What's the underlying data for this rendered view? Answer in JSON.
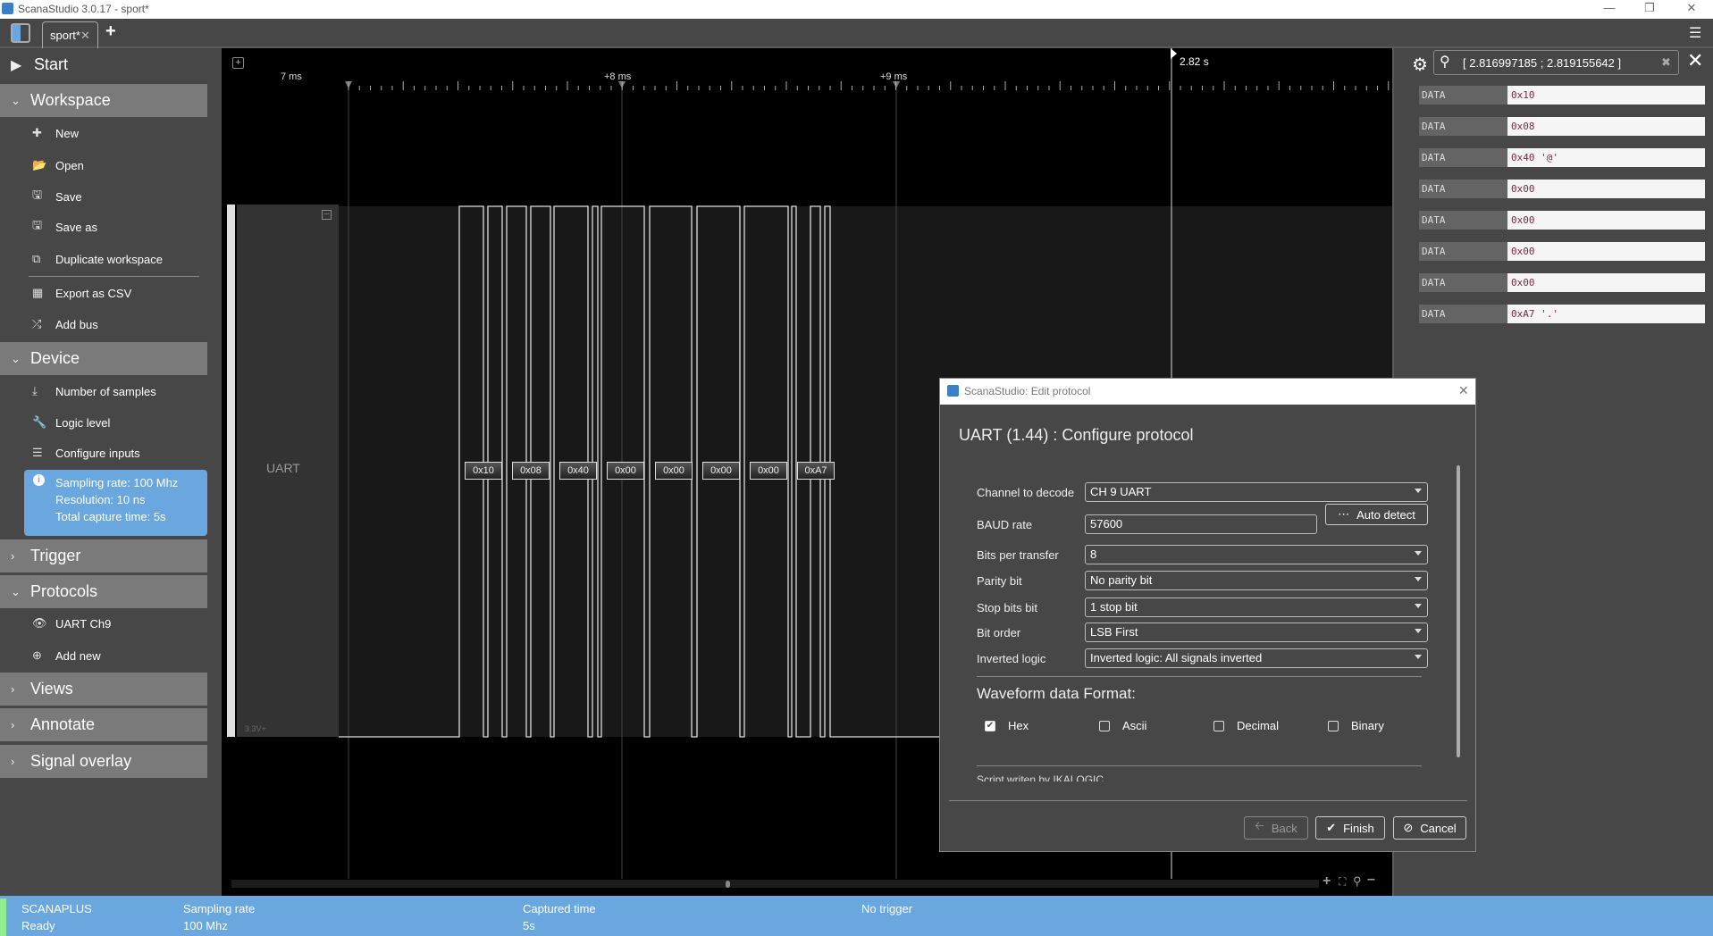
{
  "window": {
    "title": "ScanaStudio 3.0.17 - sport*"
  },
  "tabs": [
    {
      "label": "sport*"
    }
  ],
  "sidebar": {
    "start": "Start",
    "workspace": {
      "label": "Workspace",
      "items": [
        "New",
        "Open",
        "Save",
        "Save as",
        "Duplicate workspace",
        "Export as CSV",
        "Add bus"
      ]
    },
    "device": {
      "label": "Device",
      "items": [
        "Number of samples",
        "Logic level",
        "Configure inputs"
      ],
      "info": [
        "Sampling rate: 100 Mhz",
        "Resolution: 10 ns",
        "Total capture time: 5s"
      ]
    },
    "trigger": "Trigger",
    "protocols": {
      "label": "Protocols",
      "items": [
        "UART Ch9",
        "Add new"
      ]
    },
    "views": "Views",
    "annotate": "Annotate",
    "signal_overlay": "Signal overlay"
  },
  "waveform": {
    "time_labels": [
      "7 ms",
      "+8 ms",
      "+9 ms"
    ],
    "cursor_label": "2.82 s",
    "channel_name": "UART",
    "channel_voltage": "3.3V+",
    "decoded": [
      "0x10",
      "0x08",
      "0x40",
      "0x00",
      "0x00",
      "0x00",
      "0x00",
      "0xA7"
    ]
  },
  "results": {
    "search_value": "[ 2.816997185 ; 2.819155642 ]",
    "rows": [
      {
        "k": "DATA",
        "v": "0x10"
      },
      {
        "k": "DATA",
        "v": "0x08"
      },
      {
        "k": "DATA",
        "v": "0x40 '@'"
      },
      {
        "k": "DATA",
        "v": "0x00"
      },
      {
        "k": "DATA",
        "v": "0x00"
      },
      {
        "k": "DATA",
        "v": "0x00"
      },
      {
        "k": "DATA",
        "v": "0x00"
      },
      {
        "k": "DATA",
        "v": "0xA7 '.'"
      }
    ]
  },
  "dialog": {
    "title": "ScanaStudio: Edit protocol",
    "heading": "UART (1.44) : Configure protocol",
    "fields": [
      {
        "label": "Channel to decode",
        "value": "CH 9 UART"
      },
      {
        "label": "BAUD rate",
        "value": "57600"
      },
      {
        "label": "Bits per transfer",
        "value": "8"
      },
      {
        "label": "Parity bit",
        "value": "No parity bit"
      },
      {
        "label": "Stop bits bit",
        "value": "1 stop bit"
      },
      {
        "label": "Bit order",
        "value": "LSB First"
      },
      {
        "label": "Inverted logic",
        "value": "Inverted logic: All signals inverted"
      }
    ],
    "auto_detect": "Auto detect",
    "format_heading": "Waveform data Format:",
    "formats": [
      {
        "label": "Hex",
        "checked": true
      },
      {
        "label": "Ascii",
        "checked": false
      },
      {
        "label": "Decimal",
        "checked": false
      },
      {
        "label": "Binary",
        "checked": false
      }
    ],
    "footer_note": "Script writen by IKALOGIC",
    "back": "Back",
    "finish": "Finish",
    "cancel": "Cancel"
  },
  "status": {
    "device": "SCANAPLUS",
    "state": "Ready",
    "sampling_label": "Sampling rate",
    "sampling_value": "100 Mhz",
    "captured_label": "Captured time",
    "captured_value": "5s",
    "trigger": "No trigger"
  },
  "colors": {
    "accent": "#6aa7de",
    "ready": "#90ee90"
  }
}
